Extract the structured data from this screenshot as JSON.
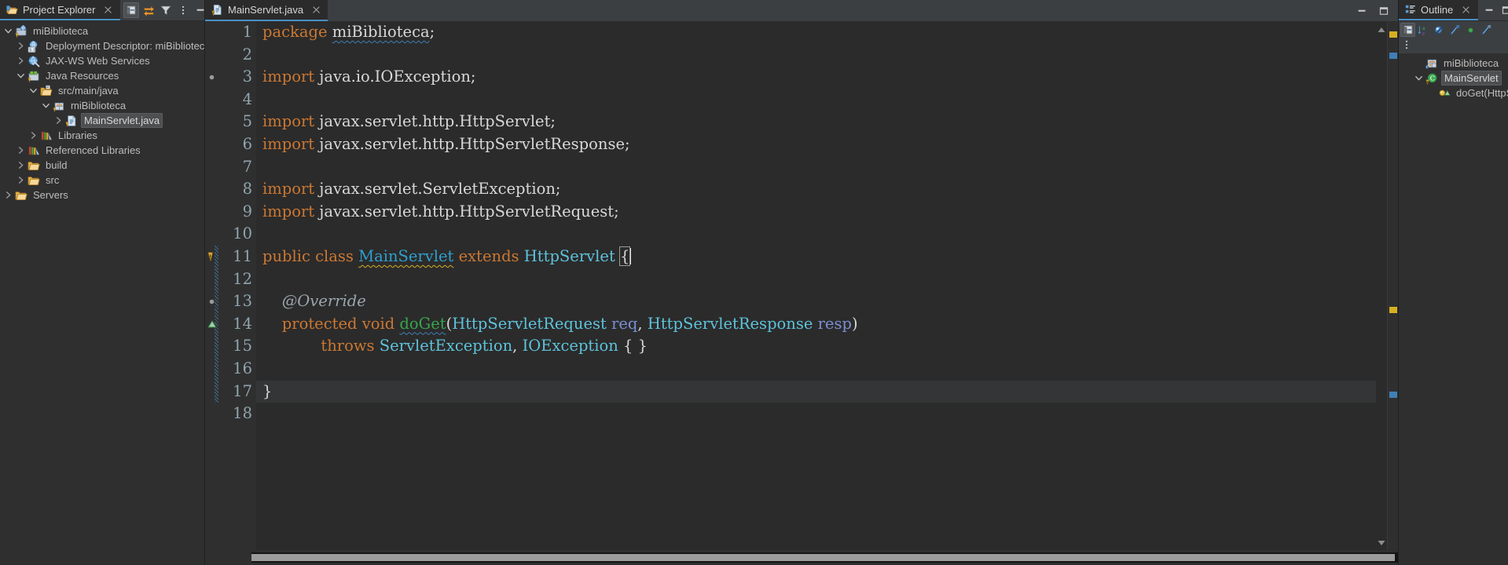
{
  "theme": {
    "bg": "#2f2f30",
    "editor_bg": "#2b2b2b",
    "tabbar_bg": "#3c3f41",
    "active_tab_underline": "#4a90c4",
    "keyword": "#cc7832",
    "type": "#5ec3db",
    "declared_class": "#2f9fd0",
    "method": "#36a64f",
    "parameter": "#7b8fd4",
    "annotation_comment": "#9aa7ad",
    "line_number": "#8fa5ad",
    "warning_squiggle": "#d6b021",
    "info_squiggle": "#3f7fb5",
    "current_line": "#343536"
  },
  "project_explorer": {
    "tab_label": "Project Explorer",
    "tab_icon": "project-explorer-icon",
    "close_icon": "close-icon",
    "toolbar": [
      {
        "name": "collapse-all-button",
        "icon": "collapse-all-icon",
        "tooltip": "Collapse All",
        "active": true
      },
      {
        "name": "link-with-editor-button",
        "icon": "link-with-editor-icon",
        "tooltip": "Link with Editor",
        "active": false
      },
      {
        "name": "filter-button",
        "icon": "filter-icon",
        "tooltip": "Filters",
        "active": false
      },
      {
        "name": "view-menu-button",
        "icon": "kebab-menu-icon",
        "tooltip": "View Menu",
        "active": false
      }
    ],
    "window_buttons": [
      {
        "name": "minimize-button",
        "icon": "minimize-icon"
      },
      {
        "name": "maximize-button",
        "icon": "maximize-icon"
      }
    ],
    "tree": [
      {
        "label": "miBiblioteca",
        "indent": 0,
        "twisty": "down",
        "icon": "dynamic-web-project-icon",
        "selected": false
      },
      {
        "label": "Deployment Descriptor: miBiblioteca",
        "indent": 1,
        "twisty": "right",
        "icon": "deployment-descriptor-icon",
        "selected": false
      },
      {
        "label": "JAX-WS Web Services",
        "indent": 1,
        "twisty": "right",
        "icon": "jaxws-icon",
        "selected": false
      },
      {
        "label": "Java Resources",
        "indent": 1,
        "twisty": "down",
        "icon": "java-resources-icon",
        "selected": false
      },
      {
        "label": "src/main/java",
        "indent": 2,
        "twisty": "down",
        "icon": "source-folder-icon",
        "selected": false
      },
      {
        "label": "miBiblioteca",
        "indent": 3,
        "twisty": "down",
        "icon": "package-icon",
        "selected": false
      },
      {
        "label": "MainServlet.java",
        "indent": 4,
        "twisty": "right",
        "icon": "java-file-icon",
        "selected": true
      },
      {
        "label": "Libraries",
        "indent": 2,
        "twisty": "right",
        "icon": "libraries-icon",
        "selected": false
      },
      {
        "label": "Referenced Libraries",
        "indent": 1,
        "twisty": "right",
        "icon": "libraries-icon",
        "selected": false
      },
      {
        "label": "build",
        "indent": 1,
        "twisty": "right",
        "icon": "folder-icon",
        "selected": false
      },
      {
        "label": "src",
        "indent": 1,
        "twisty": "right",
        "icon": "folder-icon",
        "selected": false
      },
      {
        "label": "Servers",
        "indent": 0,
        "twisty": "right",
        "icon": "folder-icon",
        "selected": false
      }
    ]
  },
  "editor": {
    "tab_label": "MainServlet.java",
    "tab_icon": "java-file-warning-icon",
    "close_icon": "close-icon",
    "window_buttons": [
      {
        "name": "minimize-button",
        "icon": "minimize-icon"
      },
      {
        "name": "maximize-button",
        "icon": "maximize-icon"
      }
    ],
    "current_line": 17,
    "scroll": {
      "h_thumb_left_pct": 0,
      "h_thumb_width_pct": 100
    },
    "overview_marks": [
      {
        "name": "overview-warning-mark",
        "color": "#d6b021",
        "top_pct": 2
      },
      {
        "name": "overview-selection-mark",
        "color": "#3f7fb5",
        "top_pct": 6
      },
      {
        "name": "overview-class-mark",
        "color": "#d6b021",
        "top_pct": 54
      },
      {
        "name": "overview-method-mark",
        "color": "#3f7fb5",
        "top_pct": 70
      }
    ],
    "lines": [
      {
        "n": 1,
        "marker": "",
        "tokens": [
          {
            "t": "package",
            "c": "kw"
          },
          {
            "t": " ",
            "c": "pl"
          },
          {
            "t": "miBiblioteca",
            "c": "pl sq-b"
          },
          {
            "t": ";",
            "c": "pl"
          }
        ]
      },
      {
        "n": 2,
        "marker": "",
        "tokens": []
      },
      {
        "n": 3,
        "marker": "collapse",
        "tokens": [
          {
            "t": "import",
            "c": "kw"
          },
          {
            "t": " java.io.IOException;",
            "c": "pl"
          }
        ]
      },
      {
        "n": 4,
        "marker": "",
        "tokens": []
      },
      {
        "n": 5,
        "marker": "",
        "tokens": [
          {
            "t": "import",
            "c": "kw"
          },
          {
            "t": " javax.servlet.http.HttpServlet;",
            "c": "pl"
          }
        ]
      },
      {
        "n": 6,
        "marker": "",
        "tokens": [
          {
            "t": "import",
            "c": "kw"
          },
          {
            "t": " javax.servlet.http.HttpServletResponse;",
            "c": "pl"
          }
        ]
      },
      {
        "n": 7,
        "marker": "",
        "tokens": []
      },
      {
        "n": 8,
        "marker": "",
        "tokens": [
          {
            "t": "import",
            "c": "kw"
          },
          {
            "t": " javax.servlet.ServletException;",
            "c": "pl"
          }
        ]
      },
      {
        "n": 9,
        "marker": "",
        "tokens": [
          {
            "t": "import",
            "c": "kw"
          },
          {
            "t": " javax.servlet.http.HttpServletRequest;",
            "c": "pl"
          }
        ]
      },
      {
        "n": 10,
        "marker": "",
        "tokens": []
      },
      {
        "n": 11,
        "marker": "warning",
        "tokens": [
          {
            "t": "public",
            "c": "kw"
          },
          {
            "t": " ",
            "c": "pl"
          },
          {
            "t": "class",
            "c": "kw"
          },
          {
            "t": " ",
            "c": "pl"
          },
          {
            "t": "MainServlet",
            "c": "cls sq-y"
          },
          {
            "t": " ",
            "c": "pl"
          },
          {
            "t": "extends",
            "c": "kw"
          },
          {
            "t": " ",
            "c": "pl"
          },
          {
            "t": "HttpServlet",
            "c": "type"
          },
          {
            "t": " ",
            "c": "pl"
          },
          {
            "t": "{",
            "c": "pl brace-box"
          }
        ]
      },
      {
        "n": 12,
        "marker": "",
        "tokens": []
      },
      {
        "n": 13,
        "marker": "collapse",
        "tokens": [
          {
            "t": "    @Override",
            "c": "ann"
          }
        ]
      },
      {
        "n": 14,
        "marker": "override",
        "tokens": [
          {
            "t": "    ",
            "c": "pl"
          },
          {
            "t": "protected",
            "c": "kw"
          },
          {
            "t": " ",
            "c": "pl"
          },
          {
            "t": "void",
            "c": "kw"
          },
          {
            "t": " ",
            "c": "pl"
          },
          {
            "t": "doGet",
            "c": "meth sq-b"
          },
          {
            "t": "(",
            "c": "pl"
          },
          {
            "t": "HttpServletRequest",
            "c": "type"
          },
          {
            "t": " ",
            "c": "pl"
          },
          {
            "t": "req",
            "c": "param"
          },
          {
            "t": ", ",
            "c": "pl"
          },
          {
            "t": "HttpServletResponse",
            "c": "type"
          },
          {
            "t": " ",
            "c": "pl"
          },
          {
            "t": "resp",
            "c": "param"
          },
          {
            "t": ")",
            "c": "pl"
          }
        ]
      },
      {
        "n": 15,
        "marker": "",
        "tokens": [
          {
            "t": "            ",
            "c": "pl"
          },
          {
            "t": "throws",
            "c": "kw"
          },
          {
            "t": " ",
            "c": "pl"
          },
          {
            "t": "ServletException",
            "c": "type"
          },
          {
            "t": ", ",
            "c": "pl"
          },
          {
            "t": "IOException",
            "c": "type"
          },
          {
            "t": " { }",
            "c": "pl"
          }
        ]
      },
      {
        "n": 16,
        "marker": "",
        "tokens": []
      },
      {
        "n": 17,
        "marker": "",
        "tokens": [
          {
            "t": "}",
            "c": "pl"
          }
        ]
      },
      {
        "n": 18,
        "marker": "",
        "tokens": []
      }
    ]
  },
  "outline": {
    "tab_label": "Outline",
    "tab_icon": "outline-icon",
    "close_icon": "close-icon",
    "window_buttons": [
      {
        "name": "minimize-button",
        "icon": "minimize-icon"
      },
      {
        "name": "maximize-button",
        "icon": "maximize-icon"
      }
    ],
    "toolbar": [
      {
        "name": "collapse-all-button",
        "icon": "collapse-all-icon",
        "tooltip": "Collapse All",
        "active": true
      },
      {
        "name": "sort-button",
        "icon": "sort-az-icon",
        "tooltip": "Sort",
        "active": false
      },
      {
        "name": "hide-fields-button",
        "icon": "hide-fields-icon",
        "tooltip": "Hide Fields",
        "active": false
      },
      {
        "name": "hide-static-button",
        "icon": "hide-static-icon",
        "tooltip": "Hide Static Fields and Methods",
        "active": false
      },
      {
        "name": "hide-nonpublic-button",
        "icon": "hide-nonpublic-icon",
        "tooltip": "Hide Non-Public Members",
        "active": false
      },
      {
        "name": "hide-local-types-button",
        "icon": "hide-local-types-icon",
        "tooltip": "Hide Local Types",
        "active": false
      },
      {
        "name": "view-menu-button",
        "icon": "kebab-menu-icon",
        "tooltip": "View Menu",
        "active": false
      }
    ],
    "tree": [
      {
        "label": "miBiblioteca",
        "indent": 1,
        "twisty": "none",
        "icon": "package-declaration-icon",
        "selected": false
      },
      {
        "label": "MainServlet",
        "indent": 1,
        "twisty": "down",
        "icon": "class-warning-icon",
        "selected": true
      },
      {
        "label": "doGet(HttpS",
        "indent": 2,
        "twisty": "none",
        "icon": "method-protected-icon",
        "selected": false
      }
    ]
  }
}
